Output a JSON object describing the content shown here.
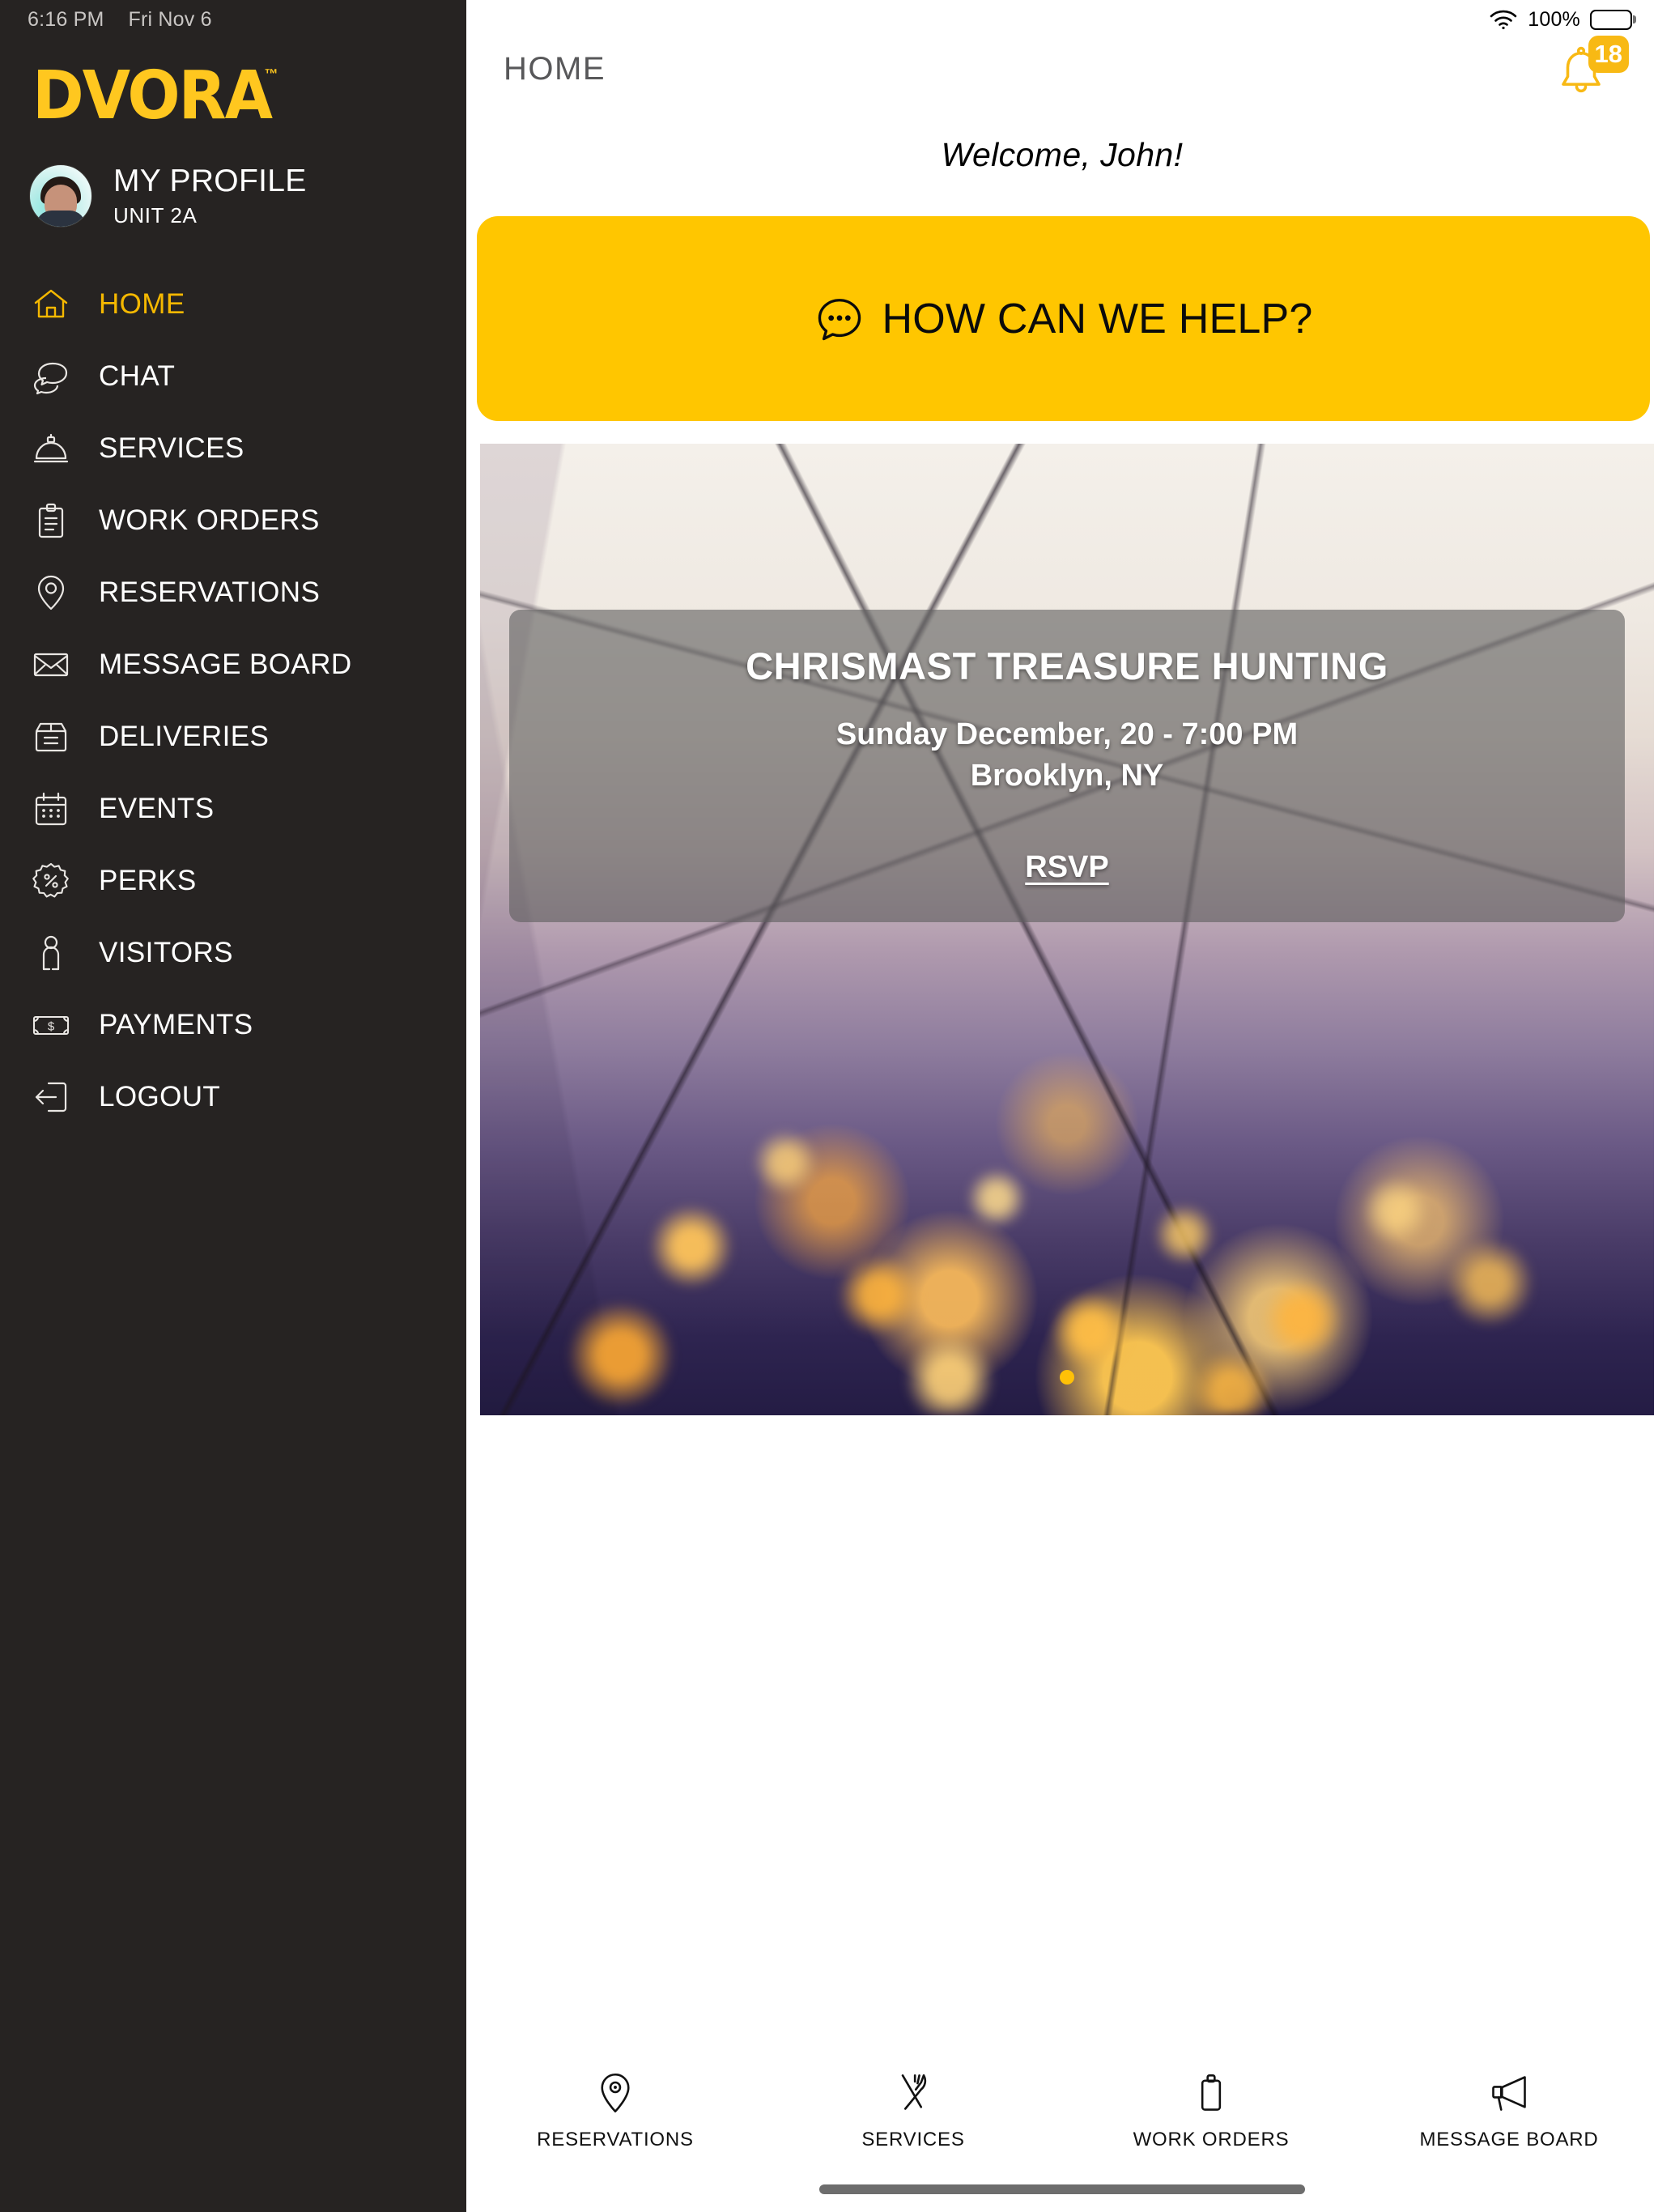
{
  "status_bar": {
    "time": "6:16 PM",
    "date": "Fri Nov 6",
    "wifi_icon": "wifi-icon",
    "battery_percent": "100%",
    "battery_icon": "battery-full-icon"
  },
  "sidebar": {
    "brand": "DVORA",
    "brand_tm": "™",
    "brand_color": "#FFC71F",
    "background_color": "#262322",
    "profile": {
      "avatar_icon": "avatar",
      "name": "MY PROFILE",
      "unit": "UNIT 2A"
    },
    "items": [
      {
        "label": "HOME",
        "icon": "home-icon",
        "active": true
      },
      {
        "label": "CHAT",
        "icon": "chat-bubbles-icon",
        "active": false
      },
      {
        "label": "SERVICES",
        "icon": "service-bell-icon",
        "active": false
      },
      {
        "label": "WORK ORDERS",
        "icon": "clipboard-icon",
        "active": false
      },
      {
        "label": "RESERVATIONS",
        "icon": "map-pin-icon",
        "active": false
      },
      {
        "label": "MESSAGE BOARD",
        "icon": "envelope-icon",
        "active": false
      },
      {
        "label": "DELIVERIES",
        "icon": "package-box-icon",
        "active": false
      },
      {
        "label": "EVENTS",
        "icon": "calendar-icon",
        "active": false
      },
      {
        "label": "PERKS",
        "icon": "percent-badge-icon",
        "active": false
      },
      {
        "label": "VISITORS",
        "icon": "person-icon",
        "active": false
      },
      {
        "label": "PAYMENTS",
        "icon": "banknote-icon",
        "active": false
      },
      {
        "label": "LOGOUT",
        "icon": "logout-arrow-icon",
        "active": false
      }
    ],
    "active_color": "#F5B800"
  },
  "header": {
    "title": "HOME",
    "notifications": {
      "icon": "bell-icon",
      "count": "18",
      "badge_color": "#F8B914"
    }
  },
  "main": {
    "welcome": "Welcome, John!",
    "help_button": {
      "label": "HOW CAN WE HELP?",
      "icon": "chat-dots-icon",
      "color": "#FFC600"
    },
    "promo": {
      "event_title": "CHRISMAST TREASURE HUNTING",
      "event_date": "Sunday December, 20 - 7:00 PM",
      "event_location": "Brooklyn, NY",
      "rsvp_label": "RSVP",
      "carousel": {
        "total": 1,
        "active_index": 0,
        "active_dot_color": "#FFC107"
      }
    }
  },
  "tabbar": {
    "tabs": [
      {
        "label": "RESERVATIONS",
        "icon": "map-pin-icon"
      },
      {
        "label": "SERVICES",
        "icon": "fork-knife-icon"
      },
      {
        "label": "WORK ORDERS",
        "icon": "clipboard-bottle-icon"
      },
      {
        "label": "MESSAGE BOARD",
        "icon": "megaphone-icon"
      }
    ]
  }
}
